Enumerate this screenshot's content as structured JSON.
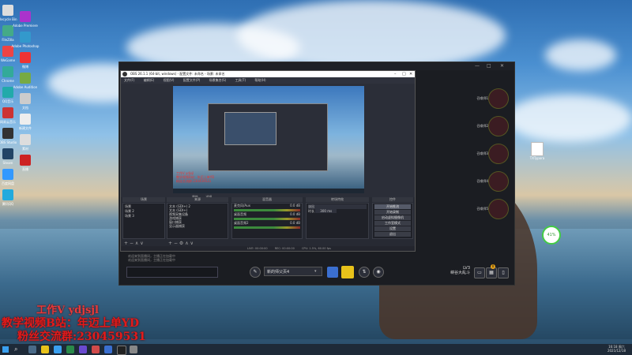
{
  "desktop": {
    "left_icons": [
      {
        "label": "Recycle Bin"
      },
      {
        "label": "FileZilla"
      },
      {
        "label": "WeGame"
      },
      {
        "label": "Chrome"
      },
      {
        "label": "QQ音乐"
      },
      {
        "label": "网易云音乐"
      },
      {
        "label": "OBS Studio"
      },
      {
        "label": "Steam"
      },
      {
        "label": "百度网盘"
      },
      {
        "label": "腾讯QQ"
      },
      {
        "label": "Adobe Premiere"
      },
      {
        "label": "Adobe Photoshop"
      },
      {
        "label": "微博"
      },
      {
        "label": "Adobe Audition"
      },
      {
        "label": "文档"
      },
      {
        "label": "新建文件"
      },
      {
        "label": "素材"
      },
      {
        "label": "直播"
      }
    ],
    "right_icon_label": "TXTypora"
  },
  "app": {
    "right_slots": [
      {
        "label": "召唤师1"
      },
      {
        "label": "召唤师2"
      },
      {
        "label": "召唤师3"
      },
      {
        "label": "召唤师4"
      },
      {
        "label": "召唤师5"
      }
    ],
    "chat_lines": [
      "欢迎来到直播间，主播正在加载中",
      "欢迎来到直播间，主播正在加载中"
    ],
    "scene_select": "新的师父页4",
    "level": "LV3",
    "rank": "峡谷大乱斗",
    "badge_count": "0"
  },
  "obs": {
    "title": "OBS 26.1.1 (64-bit, windows) - 配置文件: 未命名 - 场景: 未命名",
    "menu": [
      "文件(F)",
      "编辑(E)",
      "视图(V)",
      "配置文件(P)",
      "场景集合(S)",
      "工具(T)",
      "帮助(H)"
    ],
    "preview_text": [
      "工作V ydjsjl",
      "教学视频B站：年迈上单YD",
      "粉丝交流群:230459531"
    ],
    "below_preview": [
      "属性",
      "滤镜"
    ],
    "panel_headers": [
      "场景",
      "来源",
      "混音器",
      "转场特效",
      "控件"
    ],
    "scenes": [
      "场景",
      "场景 2",
      "场景 3"
    ],
    "sources": [
      "文本 (GDI+) 2",
      "文本 (GDI+)",
      "视频采集设备",
      "游戏捕获",
      "窗口捕获",
      "显示器捕获"
    ],
    "mixer": [
      {
        "name": "麦克风/Aux",
        "db": "0.0 dB"
      },
      {
        "name": "桌面音频",
        "db": "0.0 dB"
      },
      {
        "name": "桌面音频2",
        "db": "0.0 dB"
      }
    ],
    "transition": {
      "type": "淡出",
      "duration_label": "时长",
      "duration": "300 ms"
    },
    "controls": [
      "开始推流",
      "开始录制",
      "启动虚拟摄像机",
      "工作室模式",
      "设置",
      "退出"
    ],
    "status": {
      "live": "LIVE: 00:00:00",
      "rec": "REC: 00:00:00",
      "cpu": "CPU: 1.5%, 60.00 fps"
    }
  },
  "watermark": [
    "工作V ydjsjl",
    "教学视频B站：年迈上单YD",
    "粉丝交流群:230459531"
  ],
  "battery": "41%",
  "taskbar": {
    "time": "16:18 周六",
    "date": "2021/12/18"
  }
}
